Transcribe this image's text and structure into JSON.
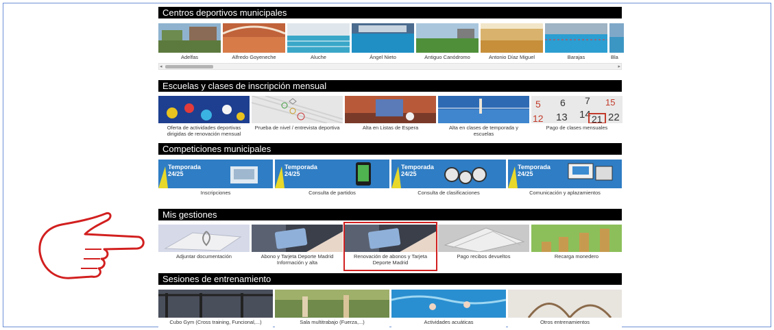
{
  "sections": {
    "centros": {
      "title": "Centros deportivos municipales",
      "items": [
        "Adelfas",
        "Alfredo Goyeneche",
        "Aluche",
        "Ángel Nieto",
        "Antiguo Canódromo",
        "Antonio Díaz Miguel",
        "Barajas",
        "Bla"
      ]
    },
    "escuelas": {
      "title": "Escuelas y clases de inscripción mensual",
      "items": [
        "Oferta de actividades deportivas dirigidas de renovación mensual",
        "Prueba de nivel / entrevista deportiva",
        "Alta en Listas de Espera",
        "Alta en clases de temporada y escuelas",
        "Pago de clases mensuales"
      ]
    },
    "competiciones": {
      "title": "Competiciones municipales",
      "banner_text": "Temporada 24/25",
      "items": [
        "Inscripciones",
        "Consulta de partidos",
        "Consulta de clasificaciones",
        "Comunicación y aplazamientos"
      ]
    },
    "gestiones": {
      "title": "Mis gestiones",
      "items": [
        "Adjuntar documentación",
        "Abono y Tarjeta Deporte Madrid Información y alta",
        "Renovación de abonos y Tarjeta Deporte Madrid",
        "Pago recibos devueltos",
        "Recarga monedero"
      ]
    },
    "sesiones": {
      "title": "Sesiones de entrenamiento",
      "items": [
        "Cubo Gym (Cross training, Funcional,...)",
        "Sala multitrabajo (Fuerza,...)",
        "Actividades acuáticas",
        "Otros entrenamientos"
      ]
    }
  },
  "calendar_numbers": [
    "5",
    "6",
    "7",
    "15",
    "12",
    "13",
    "14",
    "21",
    "22"
  ],
  "colors": {
    "section_bar": "#000000",
    "highlight": "#d21f1f",
    "frame": "#6b8fd6",
    "banner_blue": "#2f7dc4"
  }
}
